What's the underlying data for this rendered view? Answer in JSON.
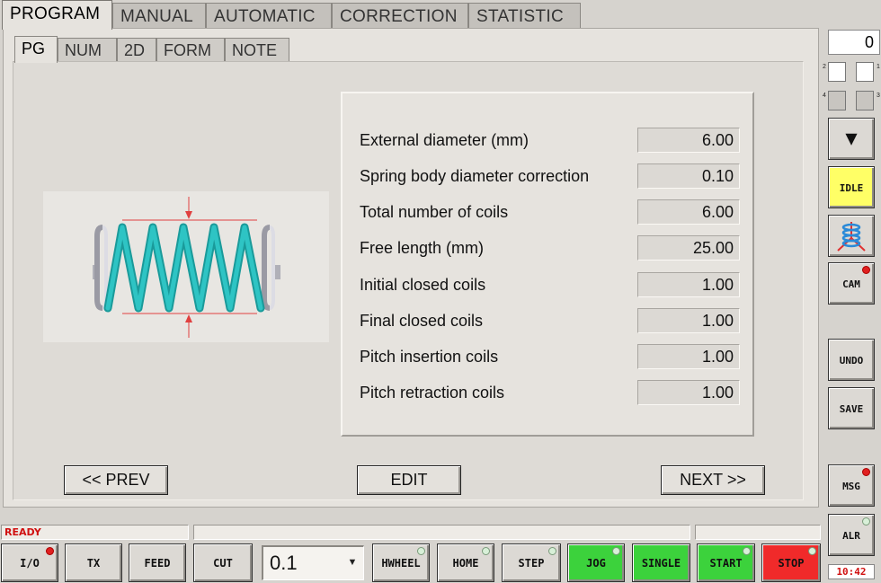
{
  "top_tabs": [
    "PROGRAM",
    "MANUAL",
    "AUTOMATIC",
    "CORRECTION",
    "STATISTIC"
  ],
  "sub_tabs": [
    "PG",
    "NUM",
    "2D",
    "FORM",
    "NOTE"
  ],
  "params": [
    {
      "label": "External diameter (mm)",
      "value": "6.00"
    },
    {
      "label": "Spring body diameter correction",
      "value": "0.10"
    },
    {
      "label": "Total number of coils",
      "value": "6.00"
    },
    {
      "label": "Free length (mm)",
      "value": "25.00"
    },
    {
      "label": "Initial closed coils",
      "value": "1.00"
    },
    {
      "label": "Final closed coils",
      "value": "1.00"
    },
    {
      "label": "Pitch insertion coils",
      "value": "1.00"
    },
    {
      "label": "Pitch retraction coils",
      "value": "1.00"
    }
  ],
  "nav": {
    "prev": "<< PREV",
    "edit": "EDIT",
    "next": "NEXT >>"
  },
  "status": {
    "text": "READY"
  },
  "bottom": {
    "io": "I/O",
    "tx": "TX",
    "feed": "FEED",
    "cut": "CUT",
    "step_value": "0.1",
    "hwheel": "HWHEEL",
    "home": "HOME",
    "step": "STEP",
    "jog": "JOG",
    "single": "SINGLE",
    "start": "START",
    "stop": "STOP"
  },
  "right": {
    "counter": "0",
    "mini_labels": [
      "2",
      "1",
      "4",
      "3"
    ],
    "idle": "IDLE",
    "cam": "CAM",
    "undo": "UNDO",
    "save": "SAVE",
    "msg": "MSG",
    "alr": "ALR",
    "clock": "10:42"
  },
  "colors": {
    "accent_green": "#3cd23c",
    "stop_red": "#f02a2a",
    "idle_yellow": "#ffff66",
    "spring_cyan": "#2ec4c4",
    "status_red": "#d01010"
  }
}
